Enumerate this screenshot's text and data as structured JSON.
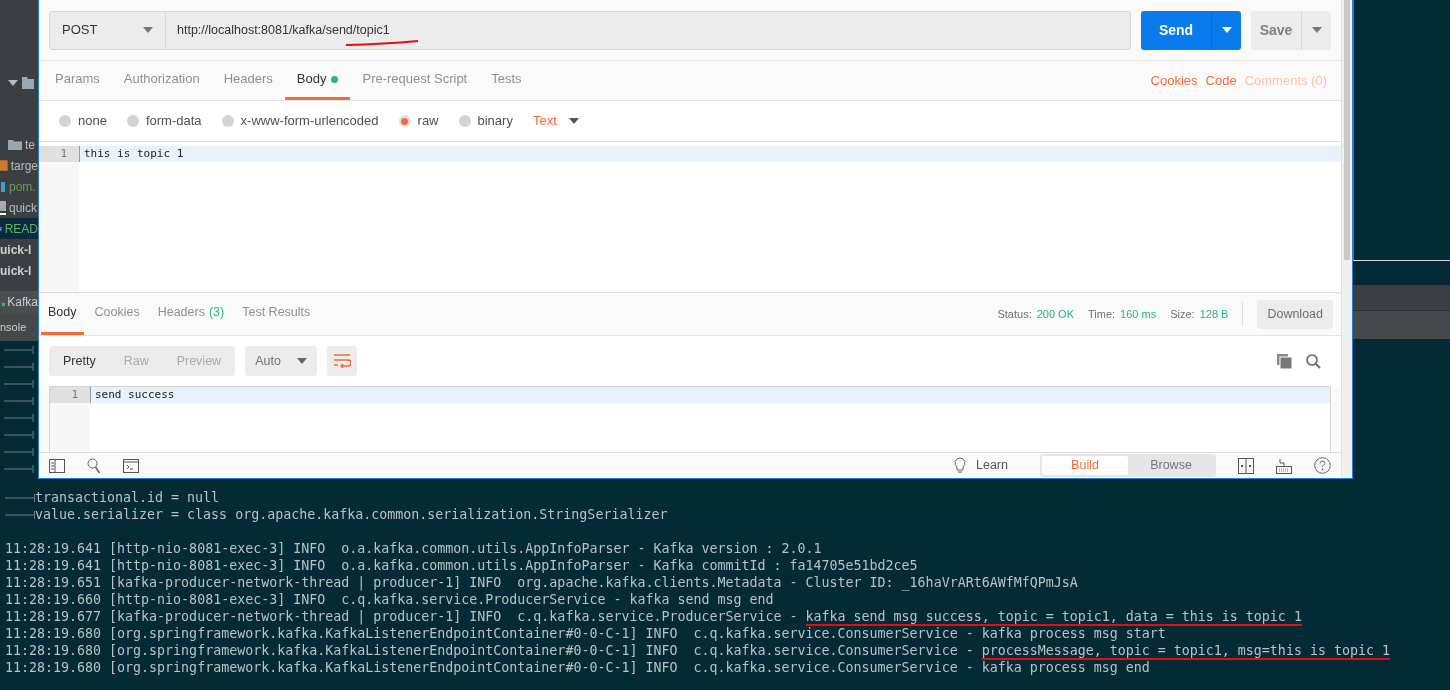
{
  "ide": {
    "tree": [
      {
        "kind": "folder",
        "label": "te",
        "selected": false
      },
      {
        "kind": "target",
        "label": "targe",
        "selected": false
      },
      {
        "kind": "maven",
        "label": "pom.",
        "selected": false
      },
      {
        "kind": "script",
        "label": "quick",
        "selected": false
      },
      {
        "kind": "readme",
        "label": "READ",
        "selected": true
      },
      {
        "kind": "module",
        "label": "uick-l",
        "selected": false
      },
      {
        "kind": "module",
        "label": "uick-l",
        "selected": false
      }
    ],
    "run_tab": "Kafka",
    "console_tab": "nsole"
  },
  "console": {
    "lines": [
      {
        "kind": "property",
        "prefix": "transactional.id = null"
      },
      {
        "kind": "property",
        "prefix": "value.serializer = class org.apache.kafka.common.serialization.StringSerializer"
      },
      {
        "kind": "gap"
      },
      {
        "kind": "log",
        "prefix": "11:28:19.641 [http-nio-8081-exec-3] INFO  o.a.kafka.common.utils.AppInfoParser - Kafka version : 2.0.1"
      },
      {
        "kind": "log",
        "prefix": "11:28:19.641 [http-nio-8081-exec-3] INFO  o.a.kafka.common.utils.AppInfoParser - Kafka commitId : fa14705e51bd2ce5"
      },
      {
        "kind": "log",
        "prefix": "11:28:19.651 [kafka-producer-network-thread | producer-1] INFO  org.apache.kafka.clients.Metadata - Cluster ID: _16haVrARt6AWfMfQPmJsA"
      },
      {
        "kind": "log",
        "prefix": "11:28:19.660 [http-nio-8081-exec-3] INFO  c.q.kafka.service.ProducerService - kafka send msg end"
      },
      {
        "kind": "log",
        "prefix": "11:28:19.677 [kafka-producer-network-thread | producer-1] INFO  c.q.kafka.service.ProducerService - ",
        "marked": "kafka send msg success, topic = topic1, data = this is topic 1"
      },
      {
        "kind": "log",
        "prefix": "11:28:19.680 [org.springframework.kafka.KafkaListenerEndpointContainer#0-0-C-1] INFO  c.q.kafka.service.ConsumerService - kafka process msg start"
      },
      {
        "kind": "log",
        "prefix": "11:28:19.680 [org.springframework.kafka.KafkaListenerEndpointContainer#0-0-C-1] INFO  c.q.kafka.service.ConsumerService - ",
        "marked": "processMessage, topic = topic1, msg=this is topic 1"
      },
      {
        "kind": "log",
        "prefix": "11:28:19.680 [org.springframework.kafka.KafkaListenerEndpointContainer#0-0-C-1] INFO  c.q.kafka.service.ConsumerService - kafka process msg end"
      }
    ]
  },
  "request": {
    "method": "POST",
    "url": "http://localhost:8081/kafka/send/topic1",
    "send": "Send",
    "save": "Save"
  },
  "request_tabs": [
    {
      "label": "Params",
      "selected": false,
      "dot": false
    },
    {
      "label": "Authorization",
      "selected": false,
      "dot": false
    },
    {
      "label": "Headers",
      "selected": false,
      "dot": false
    },
    {
      "label": "Body",
      "selected": true,
      "dot": true
    },
    {
      "label": "Pre-request Script",
      "selected": false,
      "dot": false
    },
    {
      "label": "Tests",
      "selected": false,
      "dot": false
    }
  ],
  "request_links": [
    {
      "label": "Cookies",
      "disabled": false
    },
    {
      "label": "Code",
      "disabled": false
    },
    {
      "label": "Comments (0)",
      "disabled": true
    }
  ],
  "body_modes": [
    {
      "label": "none",
      "selected": false
    },
    {
      "label": "form-data",
      "selected": false
    },
    {
      "label": "x-www-form-urlencoded",
      "selected": false
    },
    {
      "label": "raw",
      "selected": true
    },
    {
      "label": "binary",
      "selected": false
    }
  ],
  "body_format": "Text",
  "request_body": [
    {
      "number": "1",
      "text": "this is topic 1"
    }
  ],
  "response_tabs": [
    {
      "label": "Body",
      "selected": true
    },
    {
      "label": "Cookies",
      "selected": false
    },
    {
      "label": "Headers",
      "count": "(3)",
      "selected": false
    },
    {
      "label": "Test Results",
      "selected": false
    }
  ],
  "response_meta": [
    {
      "label": "Status:",
      "value": "200 OK"
    },
    {
      "label": "Time:",
      "value": "160 ms"
    },
    {
      "label": "Size:",
      "value": "128 B"
    }
  ],
  "download": "Download",
  "view_modes": [
    {
      "label": "Pretty",
      "selected": true
    },
    {
      "label": "Raw",
      "selected": false
    },
    {
      "label": "Preview",
      "selected": false
    }
  ],
  "response_format": "Auto",
  "response_body": [
    {
      "number": "1",
      "text": "send success"
    }
  ],
  "footer": {
    "learn": "Learn",
    "modes": [
      {
        "label": "Build",
        "selected": true
      },
      {
        "label": "Browse",
        "selected": false
      }
    ]
  }
}
